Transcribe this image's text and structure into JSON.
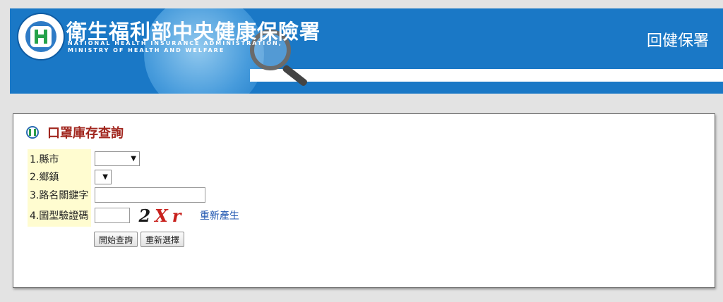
{
  "header": {
    "agency_name_zh": "衛生福利部中央健康保險署",
    "agency_name_en_line1": "NATIONAL HEALTH INSURANCE ADMINISTRATION,",
    "agency_name_en_line2": "MINISTRY OF HEALTH AND WELFARE",
    "home_link": "回健保署",
    "colors": {
      "banner": "#1a78c6",
      "accent": "#ffffff"
    }
  },
  "panel": {
    "title": "口罩庫存查詢",
    "title_color": "#a1261e",
    "form": {
      "county_label": "1.縣市",
      "county_value": "",
      "town_label": "2.鄉鎮",
      "town_value": "",
      "road_label": "3.路名關鍵字",
      "road_value": "",
      "captcha_label": "4.圖型驗證碼",
      "captcha_value": "",
      "captcha_chars": [
        "2",
        "X",
        "r"
      ],
      "regenerate_label": "重新產生"
    },
    "buttons": {
      "search": "開始查詢",
      "reset": "重新選擇"
    }
  }
}
